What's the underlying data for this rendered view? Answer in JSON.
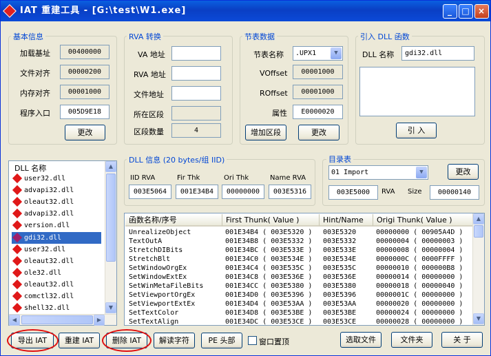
{
  "window": {
    "title": "IAT 重建工具 - [G:\\test\\W1.exe]",
    "min": "_",
    "max": "□",
    "close": "×"
  },
  "basic": {
    "title": "基本信息",
    "image_base_label": "加载基址",
    "image_base": "00400000",
    "file_align_label": "文件对齐",
    "file_align": "00000200",
    "mem_align_label": "内存对齐",
    "mem_align": "00001000",
    "entry_label": "程序入口",
    "entry": "005D9E18",
    "change_btn": "更改"
  },
  "rva": {
    "title": "RVA 转换",
    "va_label": "VA 地址",
    "va": "",
    "rva_label": "RVA 地址",
    "rva": "",
    "file_label": "文件地址",
    "file": "",
    "section_label": "所在区段",
    "section": "",
    "count_label": "区段数量",
    "count": "4"
  },
  "section": {
    "title": "节表数据",
    "name_label": "节表名称",
    "name": ".UPX1",
    "voffset_label": "VOffset",
    "voffset": "00001000",
    "roffset_label": "ROffset",
    "roffset": "00001000",
    "attr_label": "属性",
    "attr": "E0000020",
    "add_btn": "增加区段",
    "change_btn": "更改"
  },
  "importdll": {
    "title": "引入 DLL 函数",
    "name_label": "DLL 名称",
    "name": "gdi32.dll",
    "import_btn": "引  入"
  },
  "dll_list": {
    "header": "DLL 名称",
    "items": [
      "user32.dll",
      "advapi32.dll",
      "oleaut32.dll",
      "advapi32.dll",
      "version.dll",
      "gdi32.dll",
      "user32.dll",
      "oleaut32.dll",
      "ole32.dll",
      "oleaut32.dll",
      "comctl32.dll",
      "shell32.dll"
    ],
    "selected_index": 5
  },
  "dllinfo": {
    "title": "DLL 信息 (20 bytes/组 IID)",
    "iid_rva_label": "IID RVA",
    "iid_rva": "003E5064",
    "fir_thk_label": "Fir Thk",
    "fir_thk": "001E34B4",
    "ori_thk_label": "Ori Thk",
    "ori_thk": "00000000",
    "name_rva_label": "Name RVA",
    "name_rva": "003E5316"
  },
  "directory": {
    "title": "目录表",
    "selected": "01 Import",
    "change_btn": "更改",
    "rva_value": "003E5000",
    "rva_label": "RVA",
    "size_label": "Size",
    "size_value": "00000140"
  },
  "func_table": {
    "headers": [
      "函数名称/序号",
      "First Thunk( Value )",
      "Hint/Name",
      "Origi Thunk( Value )"
    ],
    "rows": [
      [
        "UnrealizeObject",
        "001E34B4 ( 003E5320 )",
        "003E5320",
        "00000000 ( 00905A4D )"
      ],
      [
        "TextOutA",
        "001E34B8 ( 003E5332 )",
        "003E5332",
        "00000004 ( 00000003 )"
      ],
      [
        "StretchDIBits",
        "001E34BC ( 003E533E )",
        "003E533E",
        "00000008 ( 00000004 )"
      ],
      [
        "StretchBlt",
        "001E34C0 ( 003E534E )",
        "003E534E",
        "0000000C ( 0000FFFF )"
      ],
      [
        "SetWindowOrgEx",
        "001E34C4 ( 003E535C )",
        "003E535C",
        "00000010 ( 000000B8 )"
      ],
      [
        "SetWindowExtEx",
        "001E34C8 ( 003E536E )",
        "003E536E",
        "00000014 ( 00000000 )"
      ],
      [
        "SetWinMetaFileBits",
        "001E34CC ( 003E5380 )",
        "003E5380",
        "00000018 ( 00000040 )"
      ],
      [
        "SetViewportOrgEx",
        "001E34D0 ( 003E5396 )",
        "003E5396",
        "0000001C ( 00000000 )"
      ],
      [
        "SetViewportExtEx",
        "001E34D4 ( 003E53AA )",
        "003E53AA",
        "00000020 ( 00000000 )"
      ],
      [
        "SetTextColor",
        "001E34D8 ( 003E53BE )",
        "003E53BE",
        "00000024 ( 00000000 )"
      ],
      [
        "SetTextAlign",
        "001E34DC ( 003E53CE )",
        "003E53CE",
        "00000028 ( 00000000 )"
      ]
    ]
  },
  "bottom": {
    "export_iat": "导出 IAT",
    "rebuild_iat": "重建 IAT",
    "delete_iat": "删除 IAT",
    "decode_str": "解读字符",
    "pe_header": "PE 头部",
    "on_top_label": "窗口置顶",
    "select_file": "选取文件",
    "folder": "文件夹",
    "about": "关  于"
  },
  "colors": {
    "title_bar": "#0a4ad0",
    "group_title": "#0046d5",
    "selection": "#316ac5",
    "highlight_oval": "#e01010",
    "dll_icon": "#e01818"
  }
}
